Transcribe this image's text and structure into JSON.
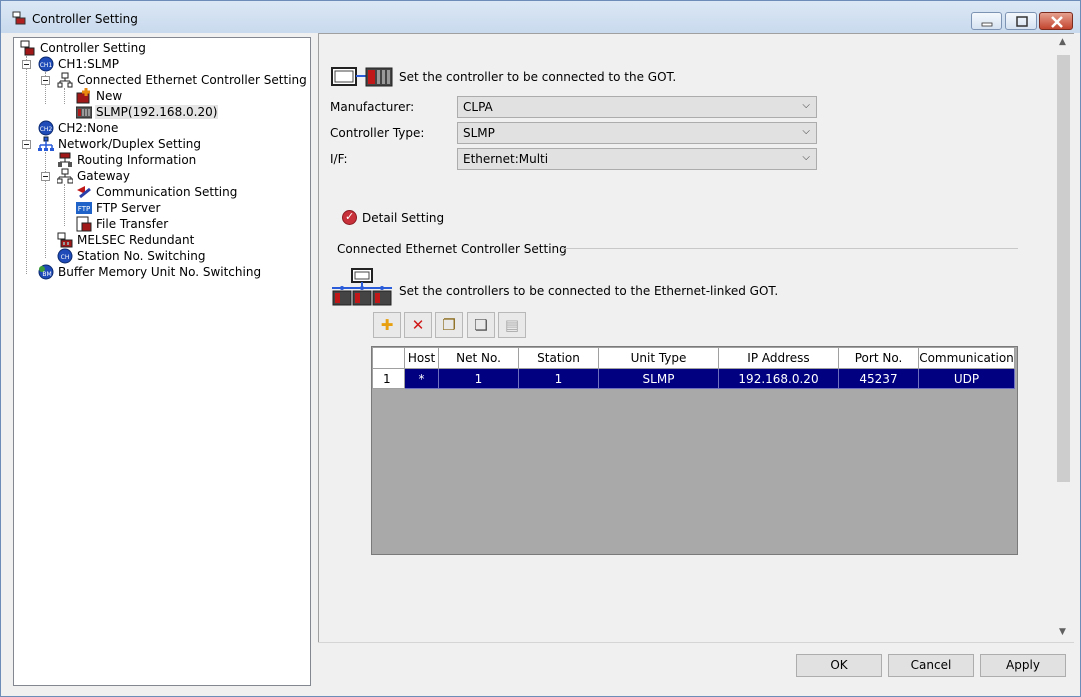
{
  "window": {
    "title": "Controller Setting"
  },
  "tree": {
    "items": [
      {
        "label": "Controller Setting",
        "icon": "controller-setting-icon"
      },
      {
        "label": "CH1:SLMP",
        "icon": "ch1-icon"
      },
      {
        "label": "Connected Ethernet Controller Setting",
        "icon": "network-icon"
      },
      {
        "label": "New",
        "icon": "new-controller-icon"
      },
      {
        "label": "SLMP(192.168.0.20)",
        "icon": "plc-icon"
      },
      {
        "label": "CH2:None",
        "icon": "ch2-icon"
      },
      {
        "label": "Network/Duplex Setting",
        "icon": "network-duplex-icon"
      },
      {
        "label": "Routing Information",
        "icon": "routing-icon"
      },
      {
        "label": "Gateway",
        "icon": "gateway-icon"
      },
      {
        "label": "Communication Setting",
        "icon": "communication-icon"
      },
      {
        "label": "FTP Server",
        "icon": "ftp-icon"
      },
      {
        "label": "File Transfer",
        "icon": "file-transfer-icon"
      },
      {
        "label": "MELSEC Redundant",
        "icon": "redundant-icon"
      },
      {
        "label": "Station No. Switching",
        "icon": "station-switch-icon"
      },
      {
        "label": "Buffer Memory Unit No. Switching",
        "icon": "buffer-memory-icon"
      }
    ]
  },
  "main": {
    "intro_text": "Set the controller to be connected to the GOT.",
    "manufacturer_label": "Manufacturer:",
    "manufacturer_value": "CLPA",
    "controller_type_label": "Controller Type:",
    "controller_type_value": "SLMP",
    "if_label": "I/F:",
    "if_value": "Ethernet:Multi",
    "detail_setting_label": "Detail Setting",
    "group_title": "Connected Ethernet Controller Setting",
    "ethernet_intro_text": "Set the controllers to be connected to the Ethernet-linked GOT."
  },
  "grid": {
    "columns": [
      "Host",
      "Net No.",
      "Station",
      "Unit Type",
      "IP Address",
      "Port No.",
      "Communication"
    ],
    "rows": [
      {
        "num": "1",
        "cells": [
          "*",
          "1",
          "1",
          "SLMP",
          "192.168.0.20",
          "45237",
          "UDP"
        ]
      }
    ]
  },
  "buttons": {
    "ok": "OK",
    "cancel": "Cancel",
    "apply": "Apply"
  },
  "colors": {
    "selection": "#000080",
    "grid_background": "#a9a9a9",
    "window_background": "#f0f0f0"
  }
}
